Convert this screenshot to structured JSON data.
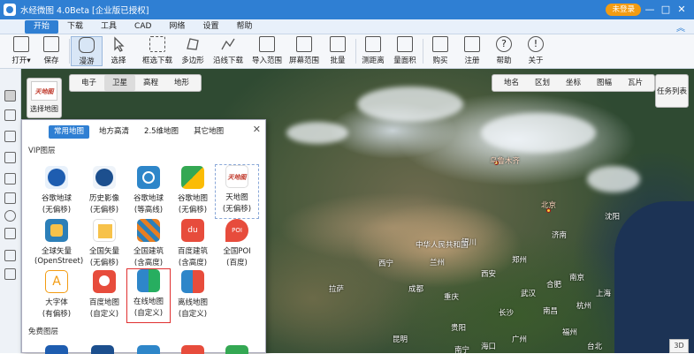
{
  "app": {
    "title": "水经微图 4.0Beta [企业版已授权]",
    "login_label": "未登录",
    "colors": {
      "accent": "#2f7fd3",
      "login": "#f39c12"
    }
  },
  "window_controls": {
    "minimize": "—",
    "maximize": "□",
    "close": "✕"
  },
  "menu": {
    "tabs": [
      "开始",
      "下载",
      "工具",
      "CAD",
      "网络",
      "设置",
      "帮助"
    ],
    "active": "开始"
  },
  "toolbar": {
    "items": [
      {
        "label": "打开",
        "icon": "folder-icon"
      },
      {
        "label": "保存",
        "icon": "save-icon"
      },
      {
        "label": "漫游",
        "icon": "hand-icon"
      },
      {
        "label": "选择",
        "icon": "cursor-icon"
      },
      {
        "label": "框选下载",
        "icon": "frame-download-icon"
      },
      {
        "label": "多边形",
        "icon": "polygon-icon"
      },
      {
        "label": "沿线下载",
        "icon": "line-download-icon"
      },
      {
        "label": "导入范围",
        "icon": "import-range-icon"
      },
      {
        "label": "屏幕范围",
        "icon": "screen-range-icon"
      },
      {
        "label": "批量",
        "icon": "batch-icon"
      },
      {
        "label": "测距离",
        "icon": "ruler-icon"
      },
      {
        "label": "量面积",
        "icon": "area-icon"
      },
      {
        "label": "购买",
        "icon": "cart-icon"
      },
      {
        "label": "注册",
        "icon": "register-icon"
      },
      {
        "label": "帮助",
        "icon": "help-icon"
      },
      {
        "label": "关于",
        "icon": "about-icon"
      }
    ],
    "open_arrow": "▾",
    "active": "漫游"
  },
  "map": {
    "type_tabs": [
      "电子",
      "卫星",
      "高程",
      "地形"
    ],
    "type_selected": "卫星",
    "region_tabs": [
      "地名",
      "区划",
      "坐标",
      "图幅",
      "瓦片"
    ],
    "task_list": "任务列表",
    "btn_3d": "3D",
    "selector": {
      "thumb": "天地图",
      "label": "选择地图"
    },
    "places": [
      {
        "name": "乌鲁木齐"
      },
      {
        "name": "北京"
      },
      {
        "name": "银川"
      },
      {
        "name": "中华人民共和国"
      },
      {
        "name": "兰州"
      },
      {
        "name": "西安"
      },
      {
        "name": "郑州"
      },
      {
        "name": "济南"
      },
      {
        "name": "南京"
      },
      {
        "name": "上海"
      },
      {
        "name": "成都"
      },
      {
        "name": "重庆"
      },
      {
        "name": "长沙"
      },
      {
        "name": "南昌"
      },
      {
        "name": "武汉"
      },
      {
        "name": "贵阳"
      },
      {
        "name": "昆明"
      },
      {
        "name": "拉萨"
      },
      {
        "name": "沈阳"
      },
      {
        "name": "西宁"
      },
      {
        "name": "合肥"
      },
      {
        "name": "杭州"
      },
      {
        "name": "福州"
      },
      {
        "name": "海口"
      },
      {
        "name": "台北"
      },
      {
        "name": "南宁"
      },
      {
        "name": "广州"
      }
    ]
  },
  "panel": {
    "tabs": [
      "常用地图",
      "地方高清",
      "2.5维地图",
      "其它地图"
    ],
    "selected_tab": "常用地图",
    "close": "✕",
    "vip_label": "VIP图层",
    "free_label": "免费图层",
    "tiles": [
      {
        "n1": "谷歌地球",
        "n2": "(无偏移)",
        "icon": "google-earth-icon",
        "color": "#1e5db0"
      },
      {
        "n1": "历史影像",
        "n2": "(无偏移)",
        "icon": "history-image-icon",
        "color": "#1c4f8e"
      },
      {
        "n1": "谷歌地球",
        "n2": "(等高线)",
        "icon": "google-contour-icon",
        "color": "#2e86c9"
      },
      {
        "n1": "谷歌地图",
        "n2": "(无偏移)",
        "icon": "google-maps-icon",
        "color": "#34a853"
      },
      {
        "n1": "天地图",
        "n2": "(无偏移)",
        "icon": "tianditu-icon",
        "color": "#ffffff"
      },
      {
        "n1": "全球矢量",
        "n2": "(OpenStreet)",
        "icon": "osm-vector-icon",
        "color": "#2c7fb8"
      },
      {
        "n1": "全国矢量",
        "n2": "(无偏移)",
        "icon": "national-vector-icon",
        "color": "#f7c24a"
      },
      {
        "n1": "全国建筑",
        "n2": "(含高度)",
        "icon": "building-icon",
        "color": "#e67e22"
      },
      {
        "n1": "百度建筑",
        "n2": "(含高度)",
        "icon": "baidu-building-icon",
        "color": "#e74c3c"
      },
      {
        "n1": "全国POI",
        "n2": "(百度)",
        "icon": "poi-icon",
        "color": "#e74c3c"
      },
      {
        "n1": "大字体",
        "n2": "(有偏移)",
        "icon": "big-font-icon",
        "color": "#f39c12"
      },
      {
        "n1": "百度地图",
        "n2": "(自定义)",
        "icon": "baidu-custom-icon",
        "color": "#e74c3c"
      },
      {
        "n1": "在线地图",
        "n2": "(自定义)",
        "icon": "online-custom-icon",
        "color": "#27ae60"
      },
      {
        "n1": "离线地图",
        "n2": "(自定义)",
        "icon": "offline-custom-icon",
        "color": "#2e86c9"
      }
    ]
  }
}
